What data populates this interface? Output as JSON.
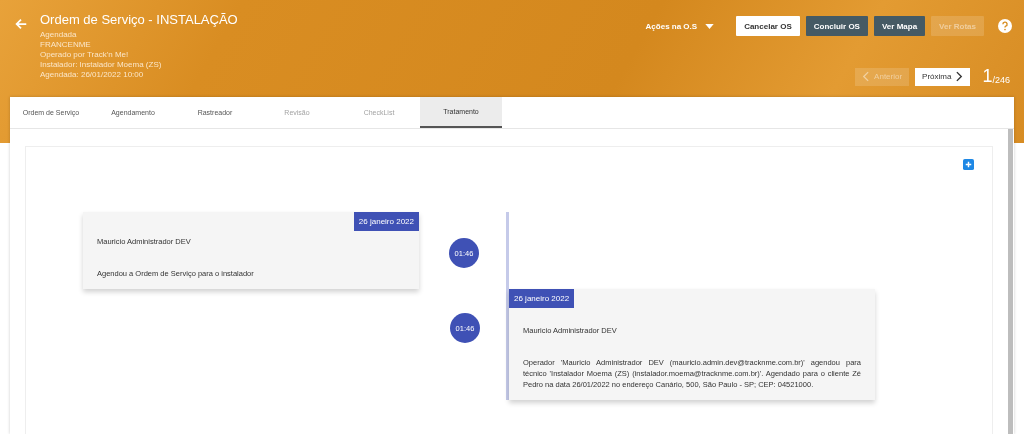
{
  "header": {
    "title": "Ordem de Serviço - INSTALAÇÃO",
    "details": [
      "Agendada",
      "FRANCENME",
      "Operado por Track'n Me!",
      "Instalador: Instalador Moema (ZS)",
      "Agendada: 26/01/2022 10:00"
    ],
    "actions_menu": "Ações na O.S",
    "buttons": [
      {
        "label": "Cancelar OS",
        "kind": "light",
        "disabled": false
      },
      {
        "label": "Concluir OS",
        "kind": "dark",
        "disabled": false
      },
      {
        "label": "Ver Mapa",
        "kind": "dark",
        "disabled": false
      },
      {
        "label": "Ver Rotas",
        "kind": "dark",
        "disabled": true
      }
    ],
    "pager": {
      "previous": {
        "label": "Anterior",
        "disabled": true
      },
      "next": {
        "label": "Próxima",
        "disabled": false
      },
      "current": "1",
      "total": "/246"
    }
  },
  "tabs": [
    {
      "label": "Ordem de Serviço",
      "selected": false,
      "disabled": false
    },
    {
      "label": "Agendamento",
      "selected": false,
      "disabled": false
    },
    {
      "label": "Rastreador",
      "selected": false,
      "disabled": false
    },
    {
      "label": "Revisão",
      "selected": false,
      "disabled": true
    },
    {
      "label": "CheckList",
      "selected": false,
      "disabled": true
    },
    {
      "label": "Tratamento",
      "selected": true,
      "disabled": false
    }
  ],
  "timeline": [
    {
      "kind": "left",
      "date": "26 janeiro 2022",
      "time": "01:46",
      "author": "Mauricio Administrador DEV",
      "text": "Agendou a Ordem de Serviço para o instalador"
    },
    {
      "kind": "right",
      "date": "26 janeiro 2022",
      "time": "01:46",
      "author": "Mauricio Administrador DEV",
      "text": "Operador 'Mauricio Administrador DEV (mauricio.admin.dev@tracknme.com.br)' agendou para técnico 'Instalador Moema (ZS) (instalador.moema@tracknme.com.br)'. Agendado para o cliente Zé Pedro na data 26/01/2022 no endereço Canário, 500, São Paulo - SP; CEP: 04521000."
    }
  ]
}
